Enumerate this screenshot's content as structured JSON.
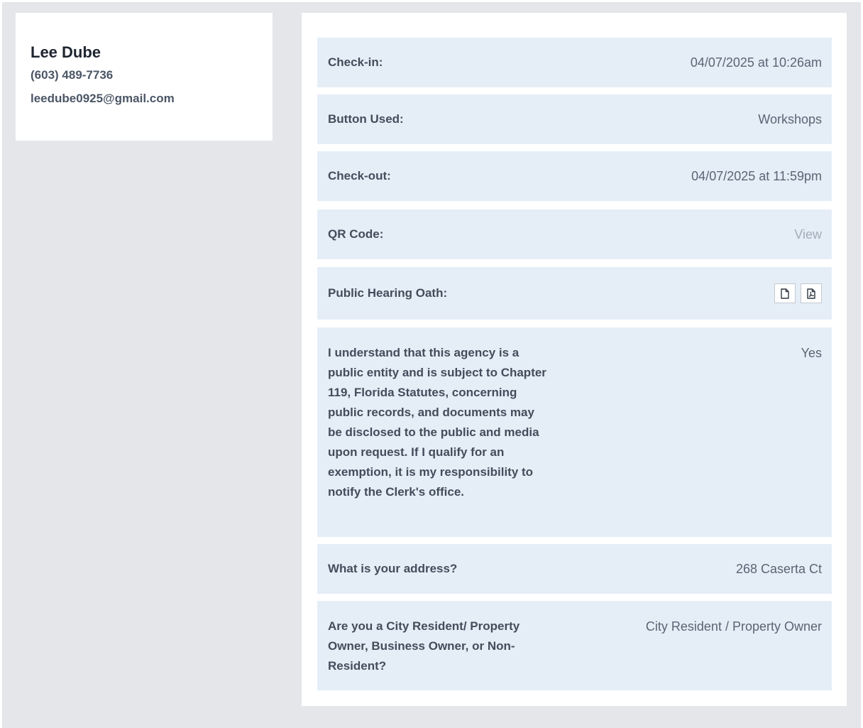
{
  "contact": {
    "name": "Lee Dube",
    "phone": "(603) 489-7736",
    "email": "leedube0925@gmail.com"
  },
  "details": {
    "checkin_label": "Check-in:",
    "checkin_value": "04/07/2025 at 10:26am",
    "button_label": "Button Used:",
    "button_value": "Workshops",
    "checkout_label": "Check-out:",
    "checkout_value": "04/07/2025 at 11:59pm",
    "qr_label": "QR Code:",
    "qr_value": "View",
    "oath_label": "Public Hearing Oath:",
    "oath_icons": [
      "document-icon",
      "pdf-icon"
    ],
    "records_label": "I understand that this agency is a public entity and is subject to Chapter 119, Florida Statutes, concerning public records, and documents may be disclosed to the public and media upon request. If I qualify for an exemption, it is my responsibility to notify the Clerk's office.",
    "records_value": "Yes",
    "address_label": "What is your address?",
    "address_value": "268 Caserta Ct",
    "resident_label": "Are you a City Resident/ Property Owner, Business Owner, or Non-Resident?",
    "resident_value": "City Resident / Property Owner"
  }
}
